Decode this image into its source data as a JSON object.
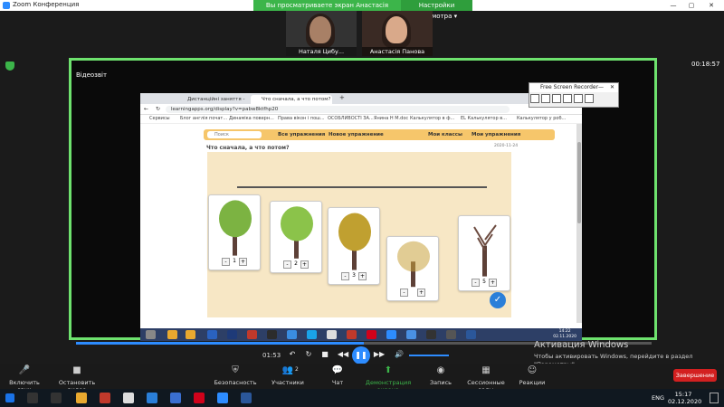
{
  "zoom": {
    "window_title": "Zoom Конференция",
    "share_banner": "Вы просматриваете экран Анастасія Панова",
    "view_options": "Настройки просмотра ▾",
    "window_controls": [
      "—",
      "▢",
      "✕"
    ],
    "timer": "00:18:57",
    "participants": [
      {
        "name": "Наталя Цибу..."
      },
      {
        "name": "Анастасія Панова"
      }
    ]
  },
  "shared": {
    "video_label": "Відеозвіт",
    "browser": {
      "tabs": [
        {
          "label": "Дистанційні заняття - Google..."
        },
        {
          "label": "Что сначала, а что потом?"
        }
      ],
      "url": "learningapps.org/display?v=pabw8ktfhp20",
      "bookmarks": [
        "Сервисы",
        "Блог англія почат...",
        "Динаміка поверн...",
        "Права вікон і пош...",
        "ОСОБЛИВОСТІ ЗА...",
        "Янина Н М.doc",
        "Калькулятор в ф...",
        "EL Калькулятор в...",
        "Калькулятор у роб..."
      ],
      "app_nav": {
        "search_placeholder": "Поиск",
        "all_exercises": "Все упражнения",
        "new_exercise": "Новое упражнение",
        "my_classes": "Мои классы",
        "my_exercises": "Мои упражнения"
      },
      "game_title": "Что сначала, а что потом?",
      "game_date": "2020-11-24",
      "cards": [
        {
          "value": "1",
          "leaf_color": "#7cb342"
        },
        {
          "value": "2",
          "leaf_color": "#8bc34a"
        },
        {
          "value": "3",
          "leaf_color": "#c0a030"
        },
        {
          "value": "",
          "leaf_color": "#c8a23c"
        },
        {
          "value": "5",
          "leaf_color": "#8d6e63"
        }
      ],
      "stepper_minus": "-",
      "stepper_plus": "+",
      "check_icon": "✓",
      "taskbar_time": "14:22",
      "taskbar_date": "02.11.2020"
    },
    "recorder": {
      "title": "Free Screen Recorder",
      "close": "✕",
      "minimize": "—"
    },
    "watermark": {
      "line1": "Активация Windows",
      "line2": "Чтобы активировать Windows, перейдите в раздел",
      "line3": "\"Параметры\"."
    }
  },
  "playback": {
    "elapsed": "01:53",
    "progress_fraction": 0.5
  },
  "toolbar": {
    "unmute": "Включить звук",
    "stop_video": "Остановить видео",
    "security": "Безопасность",
    "participants": "Участники",
    "participants_count": "2",
    "chat": "Чат",
    "share_screen": "Демонстрация экрана",
    "record": "Запись",
    "breakout": "Сессионные залы",
    "reactions": "Реакции",
    "end": "Завершение"
  },
  "windows": {
    "lang": "ENG",
    "time": "15:17",
    "date": "02.12.2020"
  },
  "colors": {
    "share_green": "#3cb54a",
    "frame_green": "#6ee26e",
    "zoom_blue": "#2d8cff",
    "end_red": "#d32020",
    "app_orange": "#f6c66b"
  }
}
